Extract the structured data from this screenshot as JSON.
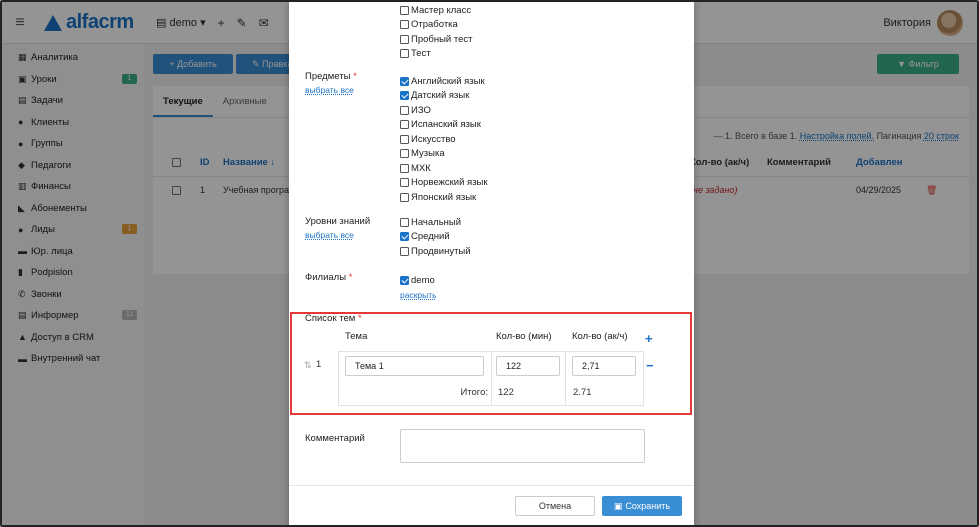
{
  "header": {
    "brand": "alfacrm",
    "branch": "demo",
    "branch_icon": "building-icon",
    "plus": "+",
    "wrench": "✎",
    "mail": "✉",
    "user_name": "Виктория"
  },
  "sidebar": {
    "items": [
      {
        "icon": "analytics-icon",
        "glyph": "▦",
        "label": "Аналитика",
        "badge": ""
      },
      {
        "icon": "calendar-icon",
        "glyph": "▣",
        "label": "Уроки",
        "badge": "1"
      },
      {
        "icon": "tasks-icon",
        "glyph": "▤",
        "label": "Задачи",
        "badge": ""
      },
      {
        "icon": "user-icon",
        "glyph": "●",
        "label": "Клиенты",
        "badge": ""
      },
      {
        "icon": "group-icon",
        "glyph": "●",
        "label": "Группы",
        "badge": ""
      },
      {
        "icon": "teacher-icon",
        "glyph": "◆",
        "label": "Педагоги",
        "badge": ""
      },
      {
        "icon": "finance-icon",
        "glyph": "▥",
        "label": "Финансы",
        "badge": ""
      },
      {
        "icon": "tag-icon",
        "glyph": "◣",
        "label": "Абонементы",
        "badge": ""
      },
      {
        "icon": "leads-icon",
        "glyph": "●",
        "label": "Лиды",
        "badge": "1"
      },
      {
        "icon": "briefcase-icon",
        "glyph": "▬",
        "label": "Юр. лица",
        "badge": ""
      },
      {
        "icon": "doc-icon",
        "glyph": "▮",
        "label": "Podpislon",
        "badge": ""
      },
      {
        "icon": "phone-icon",
        "glyph": "✆",
        "label": "Звонки",
        "badge": ""
      },
      {
        "icon": "informer-icon",
        "glyph": "▤",
        "label": "Информер",
        "badge": "11"
      },
      {
        "icon": "lock-icon",
        "glyph": "▲",
        "label": "Доступ в CRM",
        "badge": ""
      },
      {
        "icon": "chat-icon",
        "glyph": "▬",
        "label": "Внутренний чат",
        "badge": ""
      }
    ]
  },
  "main": {
    "add_label": "+ Добавить",
    "edit_label": "✎ Правка",
    "filter_label": "▼ Фильтр",
    "tabs": [
      "Текущие",
      "Архивные"
    ],
    "pager_text": "— 1. Всего в базе 1.",
    "pager_settings": "Настройка полей.",
    "pager_label": "Пагинация",
    "pager_rows": "20 строк",
    "columns": {
      "id": "ID",
      "name": "Название ↓",
      "hours": "Кол-во (ак/ч)",
      "comment": "Комментарий",
      "added": "Добавлен"
    },
    "row": {
      "id": "1",
      "name": "Учебная програм",
      "hours": "(не задано)",
      "added": "04/29/2025"
    }
  },
  "modal": {
    "top_options": [
      {
        "label": "Мастер класс",
        "checked": false
      },
      {
        "label": "Отработка",
        "checked": false
      },
      {
        "label": "Пробный тест",
        "checked": false
      },
      {
        "label": "Тест",
        "checked": false
      }
    ],
    "subjects_label": "Предметы",
    "required_mark": "*",
    "select_all": "выбрать все",
    "subjects": [
      {
        "label": "Английский язык",
        "checked": true
      },
      {
        "label": "Датский язык",
        "checked": true
      },
      {
        "label": "ИЗО",
        "checked": false
      },
      {
        "label": "Испанский язык",
        "checked": false
      },
      {
        "label": "Искусство",
        "checked": false
      },
      {
        "label": "Музыка",
        "checked": false
      },
      {
        "label": "МХК",
        "checked": false
      },
      {
        "label": "Норвежский язык",
        "checked": false
      },
      {
        "label": "Японский язык",
        "checked": false
      }
    ],
    "levels_label": "Уровни знаний",
    "levels": [
      {
        "label": "Начальный",
        "checked": false
      },
      {
        "label": "Средний",
        "checked": true
      },
      {
        "label": "Продвинутый",
        "checked": false
      }
    ],
    "branches_label": "Филиалы",
    "branches": [
      {
        "label": "demo",
        "checked": true
      }
    ],
    "expand_label": "раскрыть",
    "topics_label": "Список тем",
    "topics_headers": {
      "topic": "Тема",
      "minutes": "Кол-во (мин)",
      "hours": "Кол-во (ак/ч)"
    },
    "topics": [
      {
        "num": "1",
        "name": "Тема 1",
        "minutes": "122",
        "hours": "2,71"
      }
    ],
    "total_label": "Итого:",
    "total_minutes": "122",
    "total_hours": "2.71",
    "comment_label": "Комментарий",
    "cancel_label": "Отмена",
    "save_label": "Сохранить"
  },
  "colors": {
    "accent": "#1a73c7",
    "primary_button": "#3a8ed4",
    "filter_button": "#3db08a",
    "required": "#e53935",
    "highlight": "#e53935"
  }
}
